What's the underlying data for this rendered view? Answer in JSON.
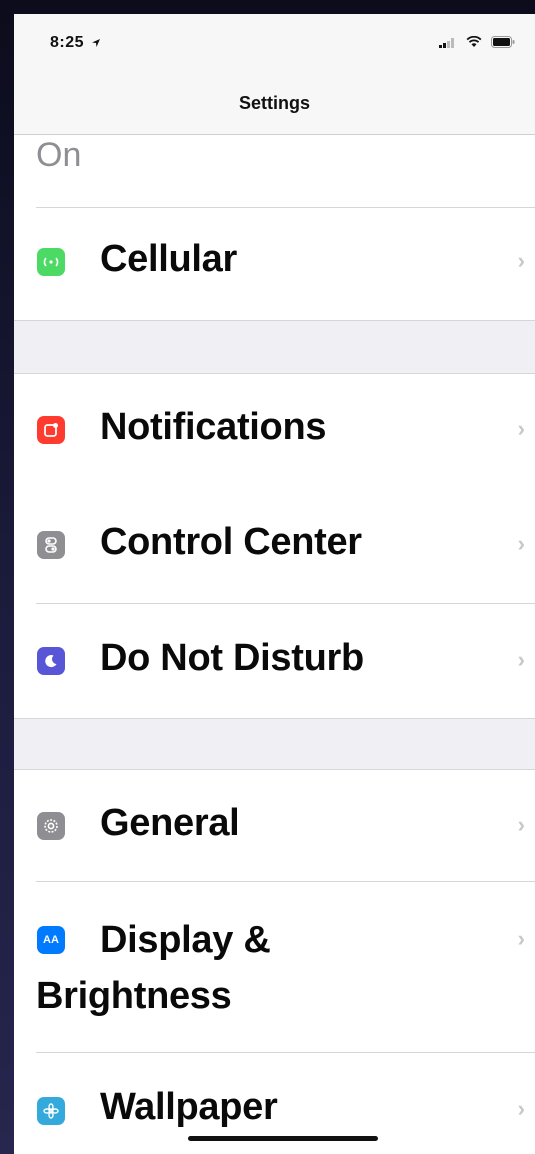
{
  "status_bar": {
    "time": "8:25",
    "location_icon": "location-arrow-icon"
  },
  "nav": {
    "title": "Settings"
  },
  "partial_row": {
    "text": "On"
  },
  "rows": [
    {
      "label": "Cellular",
      "icon": "cellular-icon",
      "color": "#4cd964"
    },
    {
      "label": "Notifications",
      "icon": "notifications-icon",
      "color": "#ff3b30"
    },
    {
      "label": "Control Center",
      "icon": "control-center-icon",
      "color": "#8e8e93"
    },
    {
      "label": "Do Not Disturb",
      "icon": "moon-icon",
      "color": "#5856d6"
    },
    {
      "label": "General",
      "icon": "gear-icon",
      "color": "#8e8e93"
    },
    {
      "label_line1": "Display &",
      "label_line2": "Brightness",
      "icon": "display-brightness-icon",
      "color": "#007aff"
    },
    {
      "label": "Wallpaper",
      "icon": "wallpaper-icon",
      "color": "#34aadc"
    }
  ],
  "chevron": "›",
  "display_icon_text": "AA"
}
